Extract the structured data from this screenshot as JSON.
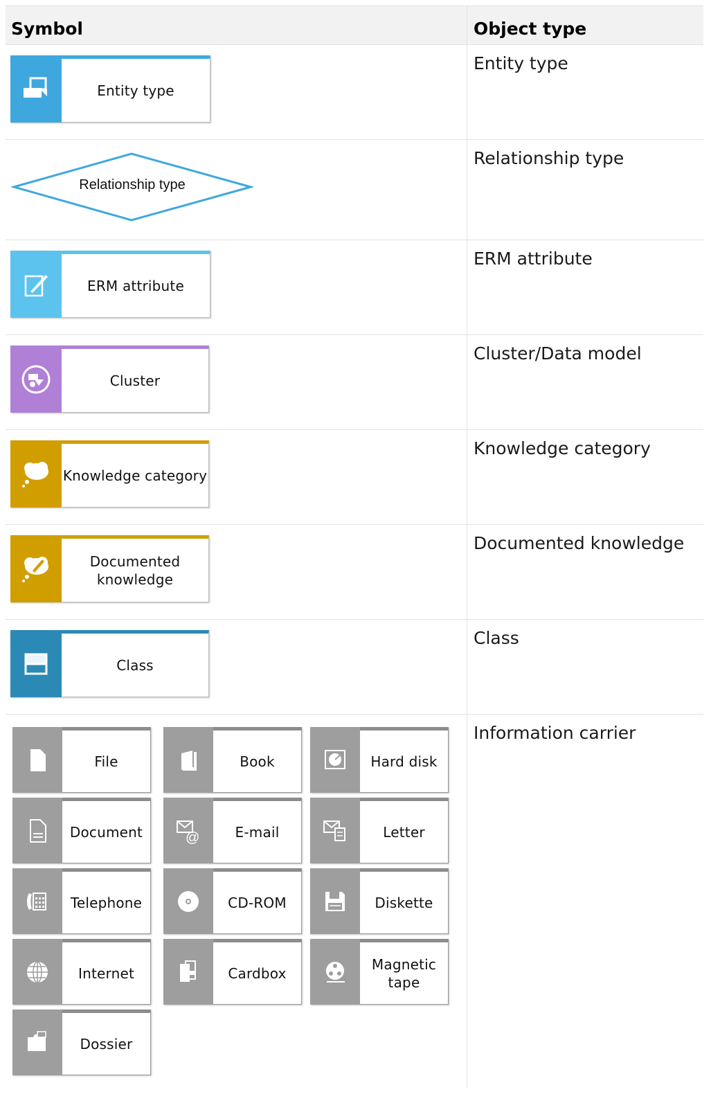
{
  "header": {
    "symbol": "Symbol",
    "object_type": "Object type"
  },
  "rows": [
    {
      "symbol_label": "Entity type",
      "object_type": "Entity type",
      "color": "#3ea8de",
      "icon": "entity-type-icon"
    },
    {
      "symbol_label": "Relationship type",
      "object_type": "Relationship type",
      "color": "#3ea8de",
      "icon": "diamond-shape"
    },
    {
      "symbol_label": "ERM attribute",
      "object_type": "ERM attribute",
      "color": "#5bc3ee",
      "icon": "pen-edit-icon"
    },
    {
      "symbol_label": "Cluster",
      "object_type": "Cluster/Data model",
      "color": "#b07fd6",
      "icon": "cluster-icon"
    },
    {
      "symbol_label": "Knowledge category",
      "object_type": "Knowledge category",
      "color": "#d19e00",
      "icon": "thought-cloud-icon"
    },
    {
      "symbol_label": "Documented knowledge",
      "object_type": "Documented knowledge",
      "color": "#d19e00",
      "icon": "thought-cloud-pen-icon"
    },
    {
      "symbol_label": "Class",
      "object_type": "Class",
      "color": "#2b8ab5",
      "icon": "class-icon"
    }
  ],
  "information_carrier": {
    "object_type": "Information carrier",
    "color": "#9e9e9e",
    "items": [
      {
        "label": "File",
        "icon": "file-icon"
      },
      {
        "label": "Book",
        "icon": "book-icon"
      },
      {
        "label": "Hard disk",
        "icon": "hard-disk-icon"
      },
      {
        "label": "Document",
        "icon": "document-icon"
      },
      {
        "label": "E-mail",
        "icon": "email-icon"
      },
      {
        "label": "Letter",
        "icon": "letter-icon"
      },
      {
        "label": "Telephone",
        "icon": "telephone-icon"
      },
      {
        "label": "CD-ROM",
        "icon": "cd-rom-icon"
      },
      {
        "label": "Diskette",
        "icon": "diskette-icon"
      },
      {
        "label": "Internet",
        "icon": "globe-icon"
      },
      {
        "label": "Cardbox",
        "icon": "cardbox-icon"
      },
      {
        "label": "Magnetic tape",
        "icon": "magnetic-tape-icon"
      },
      {
        "label": "Dossier",
        "icon": "dossier-icon"
      }
    ]
  }
}
